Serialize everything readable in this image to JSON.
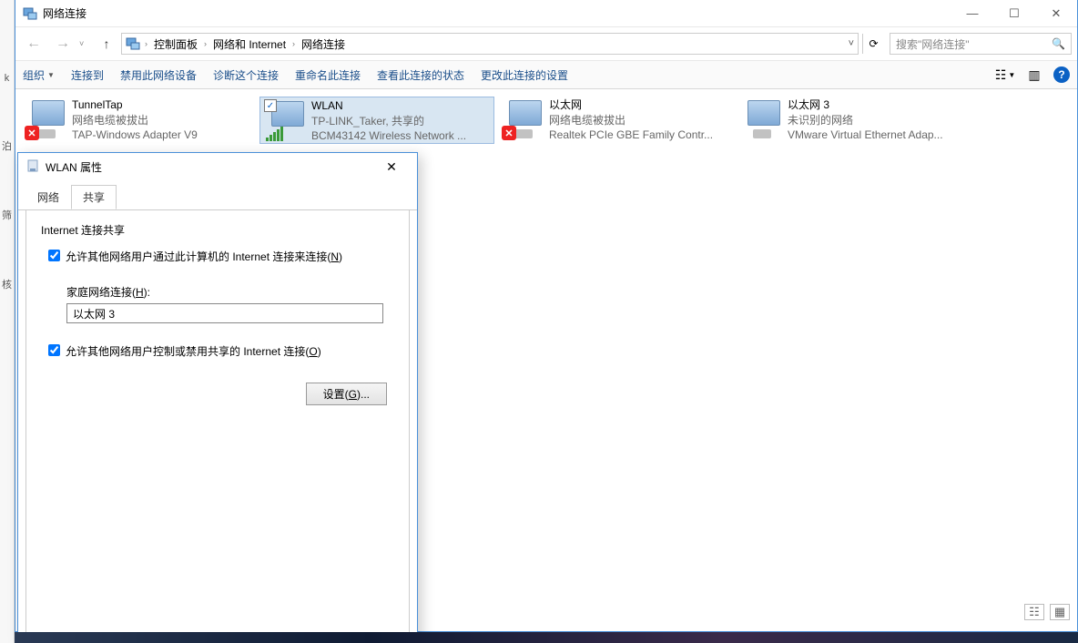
{
  "window": {
    "title": "网络连接",
    "min": "—",
    "max": "☐",
    "close": "✕"
  },
  "breadcrumb": {
    "root_dd": "›",
    "items": [
      "控制面板",
      "网络和 Internet",
      "网络连接"
    ],
    "sep": "›",
    "expand": "˅",
    "refresh": "⟳"
  },
  "search": {
    "placeholder": "搜索\"网络连接\""
  },
  "cmdbar": {
    "organize": "组织",
    "connect_to": "连接到",
    "disable": "禁用此网络设备",
    "diagnose": "诊断这个连接",
    "rename": "重命名此连接",
    "view_status": "查看此连接的状态",
    "change_settings": "更改此连接的设置"
  },
  "connections": [
    {
      "name": "TunnelTap",
      "status": "网络电缆被拔出",
      "device": "TAP-Windows Adapter V9",
      "disconnected": true,
      "wifi": false,
      "checked": false
    },
    {
      "name": "WLAN",
      "status": "TP-LINK_Taker, 共享的",
      "device": "BCM43142 Wireless Network ...",
      "disconnected": false,
      "wifi": true,
      "checked": true,
      "selected": true
    },
    {
      "name": "以太网",
      "status": "网络电缆被拔出",
      "device": "Realtek PCIe GBE Family Contr...",
      "disconnected": true,
      "wifi": false,
      "checked": false
    },
    {
      "name": "以太网 3",
      "status": "未识别的网络",
      "device": "VMware Virtual Ethernet Adap...",
      "disconnected": false,
      "wifi": false,
      "checked": false
    }
  ],
  "dialog": {
    "title": "WLAN 属性",
    "close": "✕",
    "tab_network": "网络",
    "tab_sharing": "共享",
    "section_label": "Internet 连接共享",
    "allow_connect_pre": "允许其他网络用户通过此计算机的 Internet 连接来连接(",
    "allow_connect_key": "N",
    "allow_connect_post": ")",
    "home_net_label_pre": "家庭网络连接(",
    "home_net_key": "H",
    "home_net_label_post": "):",
    "home_net_value": "以太网 3",
    "allow_control_pre": "允许其他网络用户控制或禁用共享的 Internet 连接(",
    "allow_control_key": "O",
    "allow_control_post": ")",
    "settings_btn_pre": "设置(",
    "settings_btn_key": "G",
    "settings_btn_post": ")..."
  },
  "leftsliver": {
    "a": "k",
    "b": "泊",
    "c": "筛",
    "d": "核"
  }
}
